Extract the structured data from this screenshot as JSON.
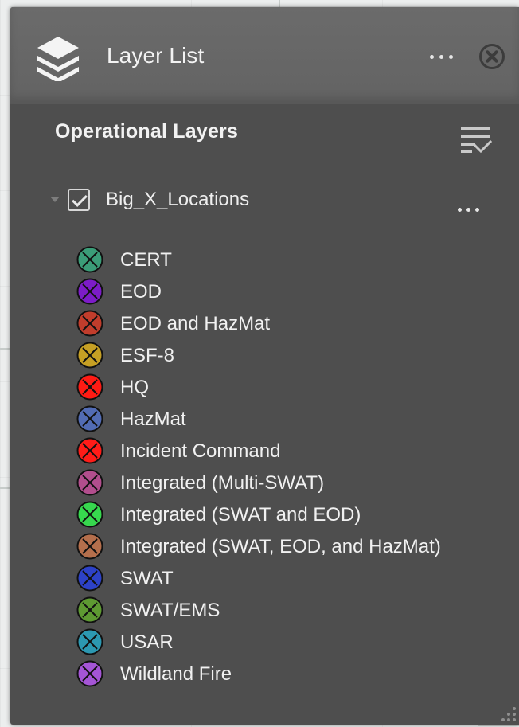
{
  "panel": {
    "title": "Layer List",
    "section_title": "Operational Layers"
  },
  "icons": {
    "header": "layers-icon",
    "more": "ellipsis-icon",
    "close": "close-icon",
    "filter": "filter-check-icon",
    "expand": "expand-arrow-icon",
    "checkbox": "checkbox-checked-icon",
    "resize": "resize-handle-icon"
  },
  "layer": {
    "name": "Big_X_Locations",
    "checked": true
  },
  "legend_items": [
    {
      "label": "CERT",
      "color": "#3b9d78"
    },
    {
      "label": "EOD",
      "color": "#7d1cc8"
    },
    {
      "label": "EOD and HazMat",
      "color": "#c13d2c"
    },
    {
      "label": "ESF-8",
      "color": "#c6a024"
    },
    {
      "label": "HQ",
      "color": "#ff1b14"
    },
    {
      "label": "HazMat",
      "color": "#526cb5"
    },
    {
      "label": "Incident Command",
      "color": "#ff1c18"
    },
    {
      "label": "Integrated (Multi-SWAT)",
      "color": "#b24e8d"
    },
    {
      "label": "Integrated (SWAT and EOD)",
      "color": "#37d84e"
    },
    {
      "label": "Integrated (SWAT, EOD, and HazMat)",
      "color": "#b56f4c"
    },
    {
      "label": "SWAT",
      "color": "#2d42c8"
    },
    {
      "label": "SWAT/EMS",
      "color": "#5e9a32"
    },
    {
      "label": "USAR",
      "color": "#2c98b1"
    },
    {
      "label": "Wildland Fire",
      "color": "#a555d6"
    }
  ]
}
